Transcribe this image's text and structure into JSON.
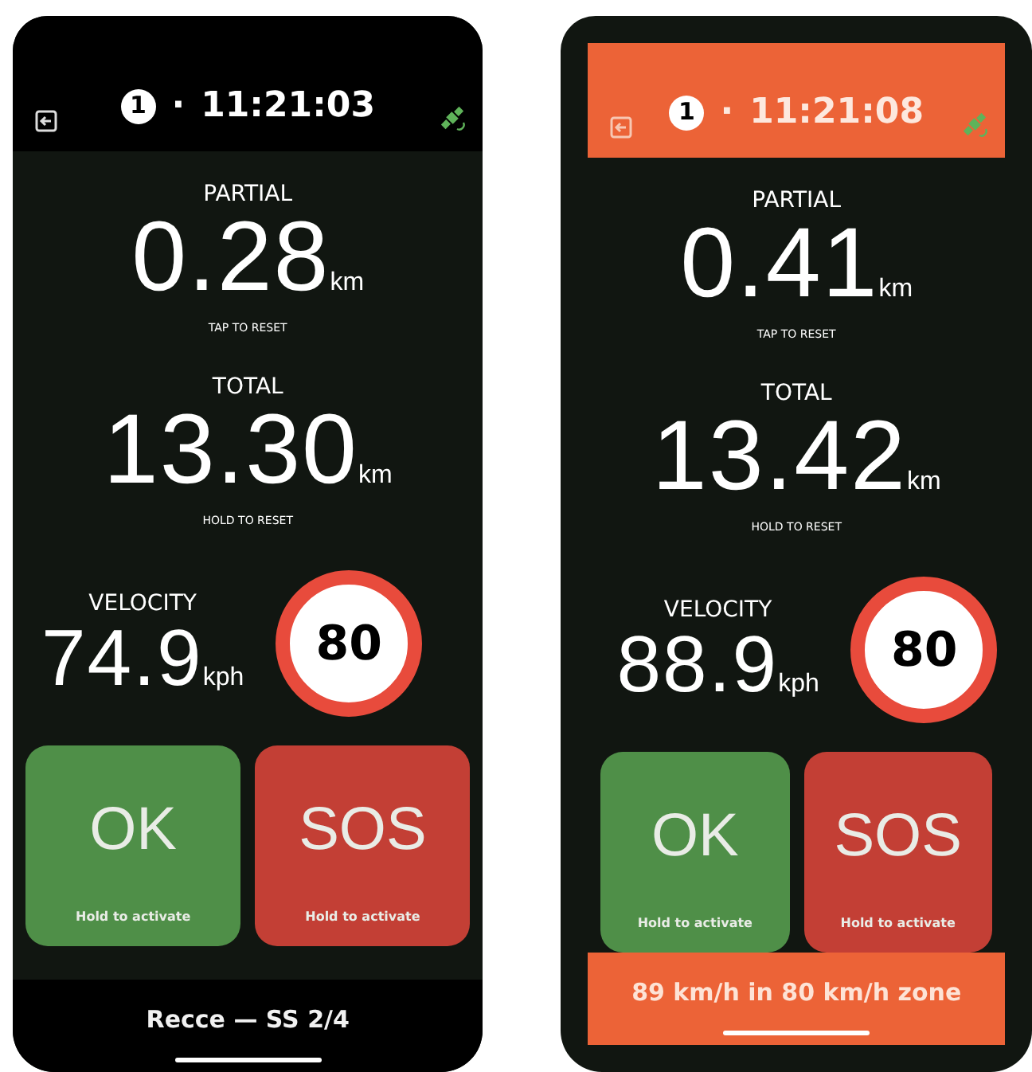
{
  "phones": [
    {
      "alert": false,
      "header": {
        "stage": "1",
        "separator": "·",
        "time": "11:21:03"
      },
      "partial": {
        "label": "PARTIAL",
        "value": "0.28",
        "unit": "km",
        "hint": "TAP TO RESET"
      },
      "total": {
        "label": "TOTAL",
        "value": "13.30",
        "unit": "km",
        "hint": "HOLD TO RESET"
      },
      "velocity": {
        "label": "VELOCITY",
        "value": "74.9",
        "unit": "kph"
      },
      "speed_limit": "80",
      "buttons": [
        {
          "kind": "ok",
          "label": "OK",
          "hint": "Hold to activate"
        },
        {
          "kind": "sos",
          "label": "SOS",
          "hint": "Hold to activate"
        }
      ],
      "status_bar": "Recce — SS 2/4"
    },
    {
      "alert": true,
      "header": {
        "stage": "1",
        "separator": "·",
        "time": "11:21:08"
      },
      "partial": {
        "label": "PARTIAL",
        "value": "0.41",
        "unit": "km",
        "hint": "TAP TO RESET"
      },
      "total": {
        "label": "TOTAL",
        "value": "13.42",
        "unit": "km",
        "hint": "HOLD TO RESET"
      },
      "velocity": {
        "label": "VELOCITY",
        "value": "88.9",
        "unit": "kph"
      },
      "speed_limit": "80",
      "buttons": [
        {
          "kind": "ok",
          "label": "OK",
          "hint": "Hold to activate"
        },
        {
          "kind": "sos",
          "label": "SOS",
          "hint": "Hold to activate"
        }
      ],
      "status_bar": "89 km/h in 80 km/h zone"
    }
  ]
}
